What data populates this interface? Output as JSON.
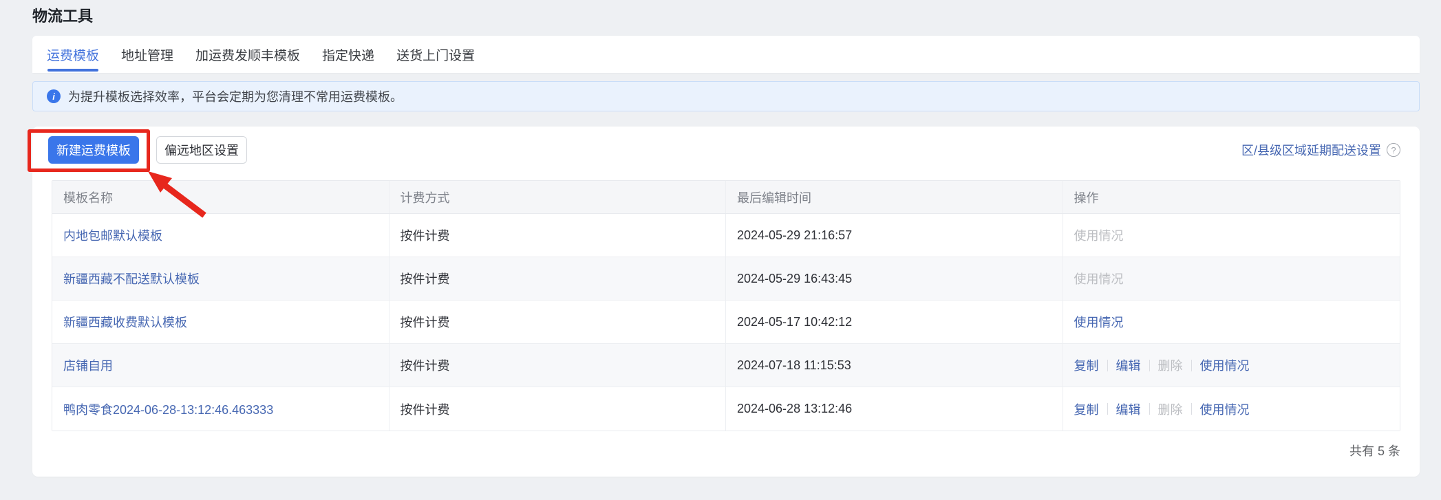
{
  "page": {
    "title": "物流工具"
  },
  "tabs": [
    {
      "label": "运费模板",
      "active": true
    },
    {
      "label": "地址管理",
      "active": false
    },
    {
      "label": "加运费发顺丰模板",
      "active": false
    },
    {
      "label": "指定快递",
      "active": false
    },
    {
      "label": "送货上门设置",
      "active": false
    }
  ],
  "banner": {
    "icon": "info-icon",
    "text": "为提升模板选择效率，平台会定期为您清理不常用运费模板。"
  },
  "toolbar": {
    "create_button": "新建运费模板",
    "remote_area_button": "偏远地区设置",
    "delay_delivery_link": "区/县级区域延期配送设置",
    "help_icon": "question-mark-icon"
  },
  "table": {
    "columns": [
      "模板名称",
      "计费方式",
      "最后编辑时间",
      "操作"
    ],
    "rows": [
      {
        "name": "内地包邮默认模板",
        "billing": "按件计费",
        "edited": "2024-05-29 21:16:57",
        "actions": [
          {
            "label": "使用情况",
            "enabled": false
          }
        ]
      },
      {
        "name": "新疆西藏不配送默认模板",
        "billing": "按件计费",
        "edited": "2024-05-29 16:43:45",
        "actions": [
          {
            "label": "使用情况",
            "enabled": false
          }
        ]
      },
      {
        "name": "新疆西藏收费默认模板",
        "billing": "按件计费",
        "edited": "2024-05-17 10:42:12",
        "actions": [
          {
            "label": "使用情况",
            "enabled": true
          }
        ]
      },
      {
        "name": "店铺自用",
        "billing": "按件计费",
        "edited": "2024-07-18 11:15:53",
        "actions": [
          {
            "label": "复制",
            "enabled": true
          },
          {
            "label": "编辑",
            "enabled": true
          },
          {
            "label": "删除",
            "enabled": false
          },
          {
            "label": "使用情况",
            "enabled": true
          }
        ]
      },
      {
        "name": "鸭肉零食2024-06-28-13:12:46.463333",
        "billing": "按件计费",
        "edited": "2024-06-28 13:12:46",
        "actions": [
          {
            "label": "复制",
            "enabled": true
          },
          {
            "label": "编辑",
            "enabled": true
          },
          {
            "label": "删除",
            "enabled": false
          },
          {
            "label": "使用情况",
            "enabled": true
          }
        ]
      }
    ]
  },
  "footer": {
    "total_text": "共有 5 条"
  },
  "annotation": {
    "shapes": [
      "red-box",
      "red-arrow"
    ],
    "target": "新建运费模板",
    "color": "#E7271D"
  },
  "colors": {
    "accent_blue": "#3A76EA",
    "link_blue": "#4667B2",
    "page_background": "#EEF0F3",
    "banner_background": "#EAF2FD",
    "disabled_gray": "#BCBEC2",
    "annotation_red": "#E7271D"
  }
}
